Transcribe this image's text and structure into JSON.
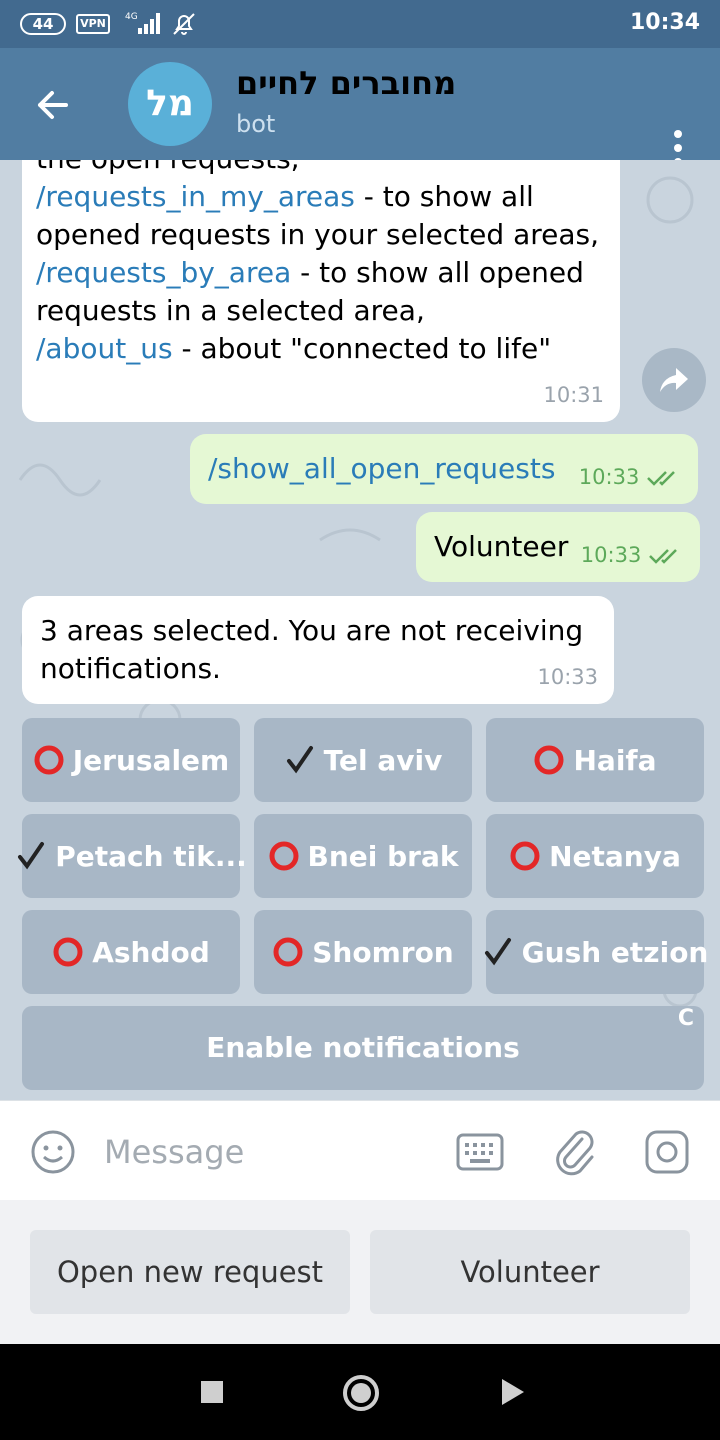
{
  "status_bar": {
    "battery": "44",
    "vpn": "VPN",
    "network": "4G",
    "time": "10:34"
  },
  "header": {
    "avatar_initials": "מל",
    "title": "מחוברים לחיים",
    "subtitle": "bot"
  },
  "messages": [
    {
      "direction": "incoming",
      "time": "10:31",
      "parts": [
        {
          "text": "the open requests,",
          "link": false
        },
        {
          "text": "/requests_in_my_areas",
          "link": true
        },
        {
          "text": " - to show all opened requests in your selected areas,",
          "link": false
        },
        {
          "text": "/requests_by_area",
          "link": true
        },
        {
          "text": " - to show all opened requests in a selected area,",
          "link": false
        },
        {
          "text": "/about_us",
          "link": true
        },
        {
          "text": " - about \"connected to life\"",
          "link": false
        }
      ]
    },
    {
      "direction": "outgoing",
      "text": "/show_all_open_requests",
      "time": "10:33",
      "read": true
    },
    {
      "direction": "outgoing",
      "text": "Volunteer",
      "time": "10:33",
      "read": true
    },
    {
      "direction": "incoming",
      "text": "3 areas selected. You are not receiving notifications.",
      "time": "10:33"
    }
  ],
  "inline_keyboard": {
    "rows": [
      [
        {
          "label": "Jerusalem",
          "state": "unselected"
        },
        {
          "label": "Tel aviv",
          "state": "selected"
        },
        {
          "label": "Haifa",
          "state": "unselected"
        }
      ],
      [
        {
          "label": "Petach tik...",
          "state": "selected"
        },
        {
          "label": "Bnei brak",
          "state": "unselected"
        },
        {
          "label": "Netanya",
          "state": "unselected"
        }
      ],
      [
        {
          "label": "Ashdod",
          "state": "unselected"
        },
        {
          "label": "Shomron",
          "state": "unselected"
        },
        {
          "label": "Gush etzion",
          "state": "selected"
        }
      ]
    ],
    "wide_button": "Enable notifications",
    "wide_button_corner": "C"
  },
  "composer": {
    "placeholder": "Message",
    "icons": [
      "emoji-icon",
      "keyboard-icon",
      "attach-icon",
      "camera-icon"
    ]
  },
  "reply_keyboard": {
    "buttons": [
      "Open new request",
      "Volunteer"
    ]
  },
  "colors": {
    "header": "#517da2",
    "status_bar": "#426a8f",
    "link": "#2a7cb8",
    "outgoing_bubble": "#e5f8d4",
    "keyboard_button": "#a8b7c6",
    "unselected_mark": "#e32727"
  }
}
